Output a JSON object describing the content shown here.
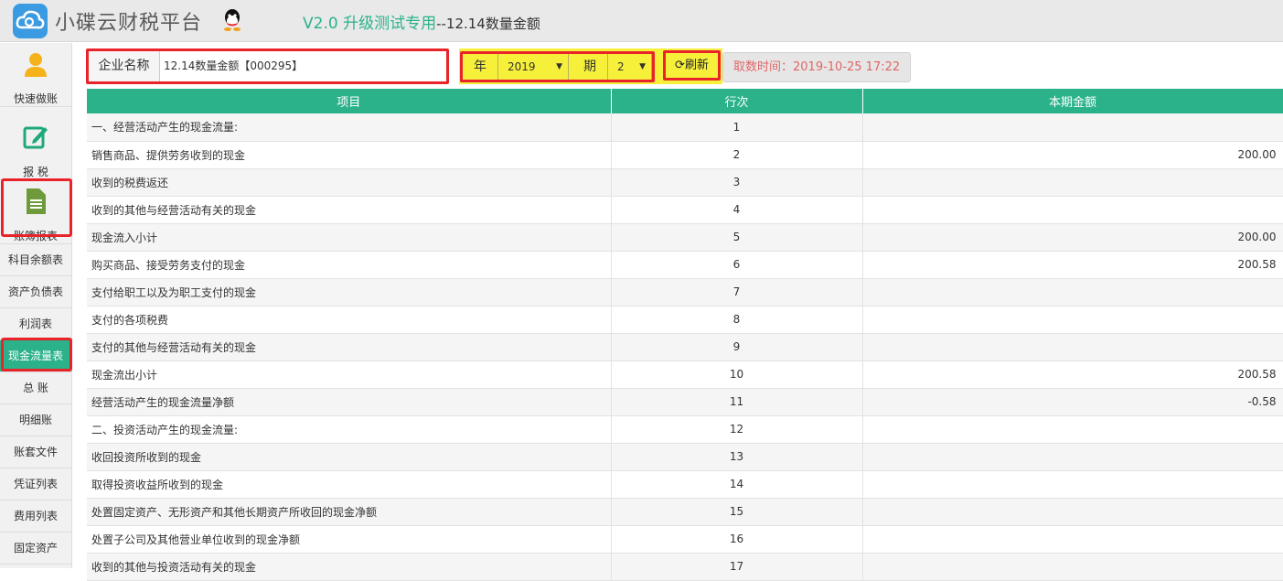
{
  "header": {
    "brand": "小碟云财税平台",
    "version": "V2.0 升级测试专用",
    "company_suffix": "--12.14数量金额",
    "accent_color": "#2bb28b"
  },
  "sidebar": {
    "big_items": [
      {
        "label": "快速做账",
        "icon": "user-icon"
      },
      {
        "label": "报 税",
        "icon": "edit-icon"
      },
      {
        "label": "账簿报表",
        "icon": "document-icon"
      }
    ],
    "items": [
      {
        "label": "科目余额表"
      },
      {
        "label": "资产负债表"
      },
      {
        "label": "利润表"
      },
      {
        "label": "现金流量表",
        "active": true
      },
      {
        "label": "总 账"
      },
      {
        "label": "明细账"
      },
      {
        "label": "账套文件"
      },
      {
        "label": "凭证列表"
      },
      {
        "label": "费用列表"
      },
      {
        "label": "固定资产"
      }
    ]
  },
  "toolbar": {
    "company_label": "企业名称",
    "company_value": "12.14数量金额【000295】",
    "year_label": "年",
    "year_value": "2019",
    "period_label": "期",
    "period_value": "2",
    "refresh_label": "刷新",
    "fetch_time": "取数时间：2019-10-25 17:22"
  },
  "table": {
    "headers": [
      "项目",
      "行次",
      "本期金额"
    ],
    "rows": [
      {
        "item": "一、经营活动产生的现金流量:",
        "line": "1",
        "amount": ""
      },
      {
        "item": "销售商品、提供劳务收到的现金",
        "line": "2",
        "amount": "200.00"
      },
      {
        "item": "收到的税费返还",
        "line": "3",
        "amount": ""
      },
      {
        "item": "收到的其他与经营活动有关的现金",
        "line": "4",
        "amount": ""
      },
      {
        "item": "现金流入小计",
        "line": "5",
        "amount": "200.00"
      },
      {
        "item": "购买商品、接受劳务支付的现金",
        "line": "6",
        "amount": "200.58"
      },
      {
        "item": "支付给职工以及为职工支付的现金",
        "line": "7",
        "amount": ""
      },
      {
        "item": "支付的各项税费",
        "line": "8",
        "amount": ""
      },
      {
        "item": "支付的其他与经营活动有关的现金",
        "line": "9",
        "amount": ""
      },
      {
        "item": "现金流出小计",
        "line": "10",
        "amount": "200.58"
      },
      {
        "item": "经营活动产生的现金流量净额",
        "line": "11",
        "amount": "-0.58"
      },
      {
        "item": "二、投资活动产生的现金流量:",
        "line": "12",
        "amount": ""
      },
      {
        "item": "收回投资所收到的现金",
        "line": "13",
        "amount": ""
      },
      {
        "item": "取得投资收益所收到的现金",
        "line": "14",
        "amount": ""
      },
      {
        "item": "处置固定资产、无形资产和其他长期资产所收回的现金净额",
        "line": "15",
        "amount": ""
      },
      {
        "item": "处置子公司及其他营业单位收到的现金净额",
        "line": "16",
        "amount": ""
      },
      {
        "item": "收到的其他与投资活动有关的现金",
        "line": "17",
        "amount": ""
      }
    ]
  }
}
